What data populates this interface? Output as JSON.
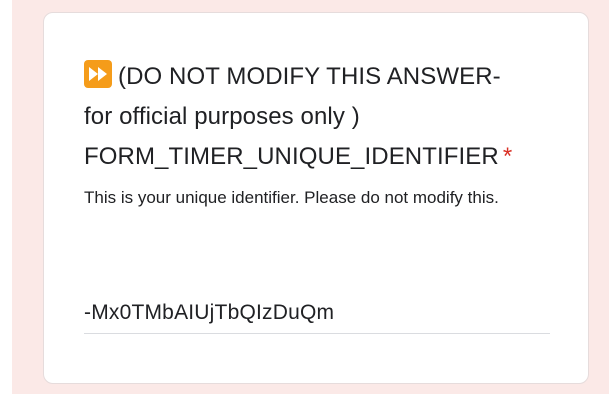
{
  "question": {
    "title_line1": "(DO NOT MODIFY THIS ANSWER-",
    "title_line2": "for official purposes only )",
    "title_line3": "FORM_TIMER_UNIQUE_IDENTIFIER",
    "required_marker": "*",
    "icon": "fast-forward-icon",
    "icon_color": "#f59c1a",
    "description": "This is your unique identifier. Please do not modify this."
  },
  "answer": {
    "value": "-Mx0TMbAIUjTbQIzDuQm"
  },
  "colors": {
    "page_background": "#fbe9e7",
    "required": "#d93025",
    "text": "#202124"
  }
}
